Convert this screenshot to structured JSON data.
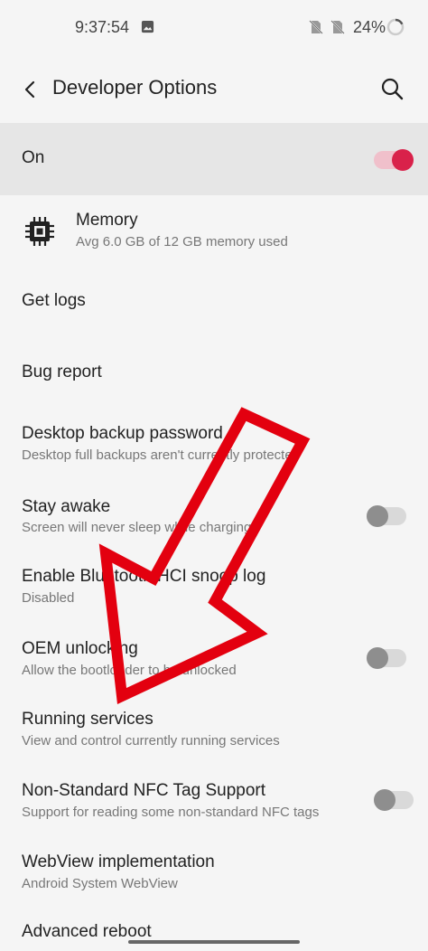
{
  "status_bar": {
    "time": "9:37:54",
    "battery": "24%",
    "icons": [
      "gallery-icon",
      "no-sim-icon",
      "no-sim-icon",
      "battery-ring-icon"
    ]
  },
  "app_bar": {
    "title": "Developer Options",
    "back_icon": "back-arrow-icon",
    "search_icon": "search-icon"
  },
  "master_switch": {
    "label": "On",
    "state": "on"
  },
  "settings": [
    {
      "title": "Memory",
      "subtitle": "Avg 6.0 GB of 12 GB memory used",
      "icon": "memory-chip-icon"
    },
    {
      "title": "Get logs"
    },
    {
      "title": "Bug report"
    },
    {
      "title": "Desktop backup password",
      "subtitle": "Desktop full backups aren't currently protected"
    },
    {
      "title": "Stay awake",
      "subtitle": "Screen will never sleep while charging",
      "toggle": "off"
    },
    {
      "title": "Enable Bluetooth HCI snoop log",
      "subtitle": "Disabled"
    },
    {
      "title": "OEM unlocking",
      "subtitle": "Allow the bootloader to be unlocked",
      "toggle": "off"
    },
    {
      "title": "Running services",
      "subtitle": "View and control currently running services"
    },
    {
      "title": "Non-Standard NFC Tag Support",
      "subtitle": "Support for reading some non-standard NFC tags",
      "toggle": "off"
    },
    {
      "title": "WebView implementation",
      "subtitle": "Android System WebView"
    },
    {
      "title": "Advanced reboot"
    }
  ],
  "colors": {
    "accent": "#d9214a",
    "annotation_arrow": "#e3000f",
    "background": "#f5f5f5",
    "highlight_row": "#e6e6e6"
  }
}
